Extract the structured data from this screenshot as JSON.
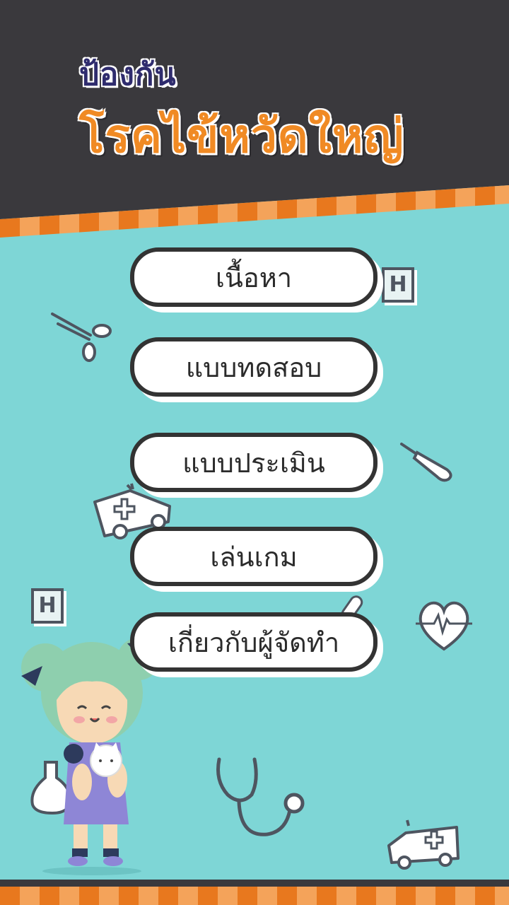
{
  "header": {
    "subtitle": "ป้องกัน",
    "title": "โรคไข้หวัดใหญ่"
  },
  "menu": [
    {
      "label": "เนื้อหา"
    },
    {
      "label": "แบบทดสอบ"
    },
    {
      "label": "แบบประเมิน"
    },
    {
      "label": "เล่นเกม"
    },
    {
      "label": "เกี่ยวกับผู้จัดทำ"
    }
  ],
  "decorations": {
    "h_sign_letter": "H",
    "icons": [
      "scissors-icon",
      "thermometer-icon",
      "ambulance-icon",
      "heart-icon",
      "pill-icon",
      "stethoscope-icon",
      "flask-icon",
      "hospital-sign-icon",
      "girl-with-cat-illustration"
    ]
  },
  "colors": {
    "header_bg": "#3a393d",
    "body_bg": "#7ed6d6",
    "title": "#f08a24",
    "subtitle": "#2f2c6e",
    "stripe_orange": "#e8781e",
    "stripe_light": "#f4a35a"
  }
}
